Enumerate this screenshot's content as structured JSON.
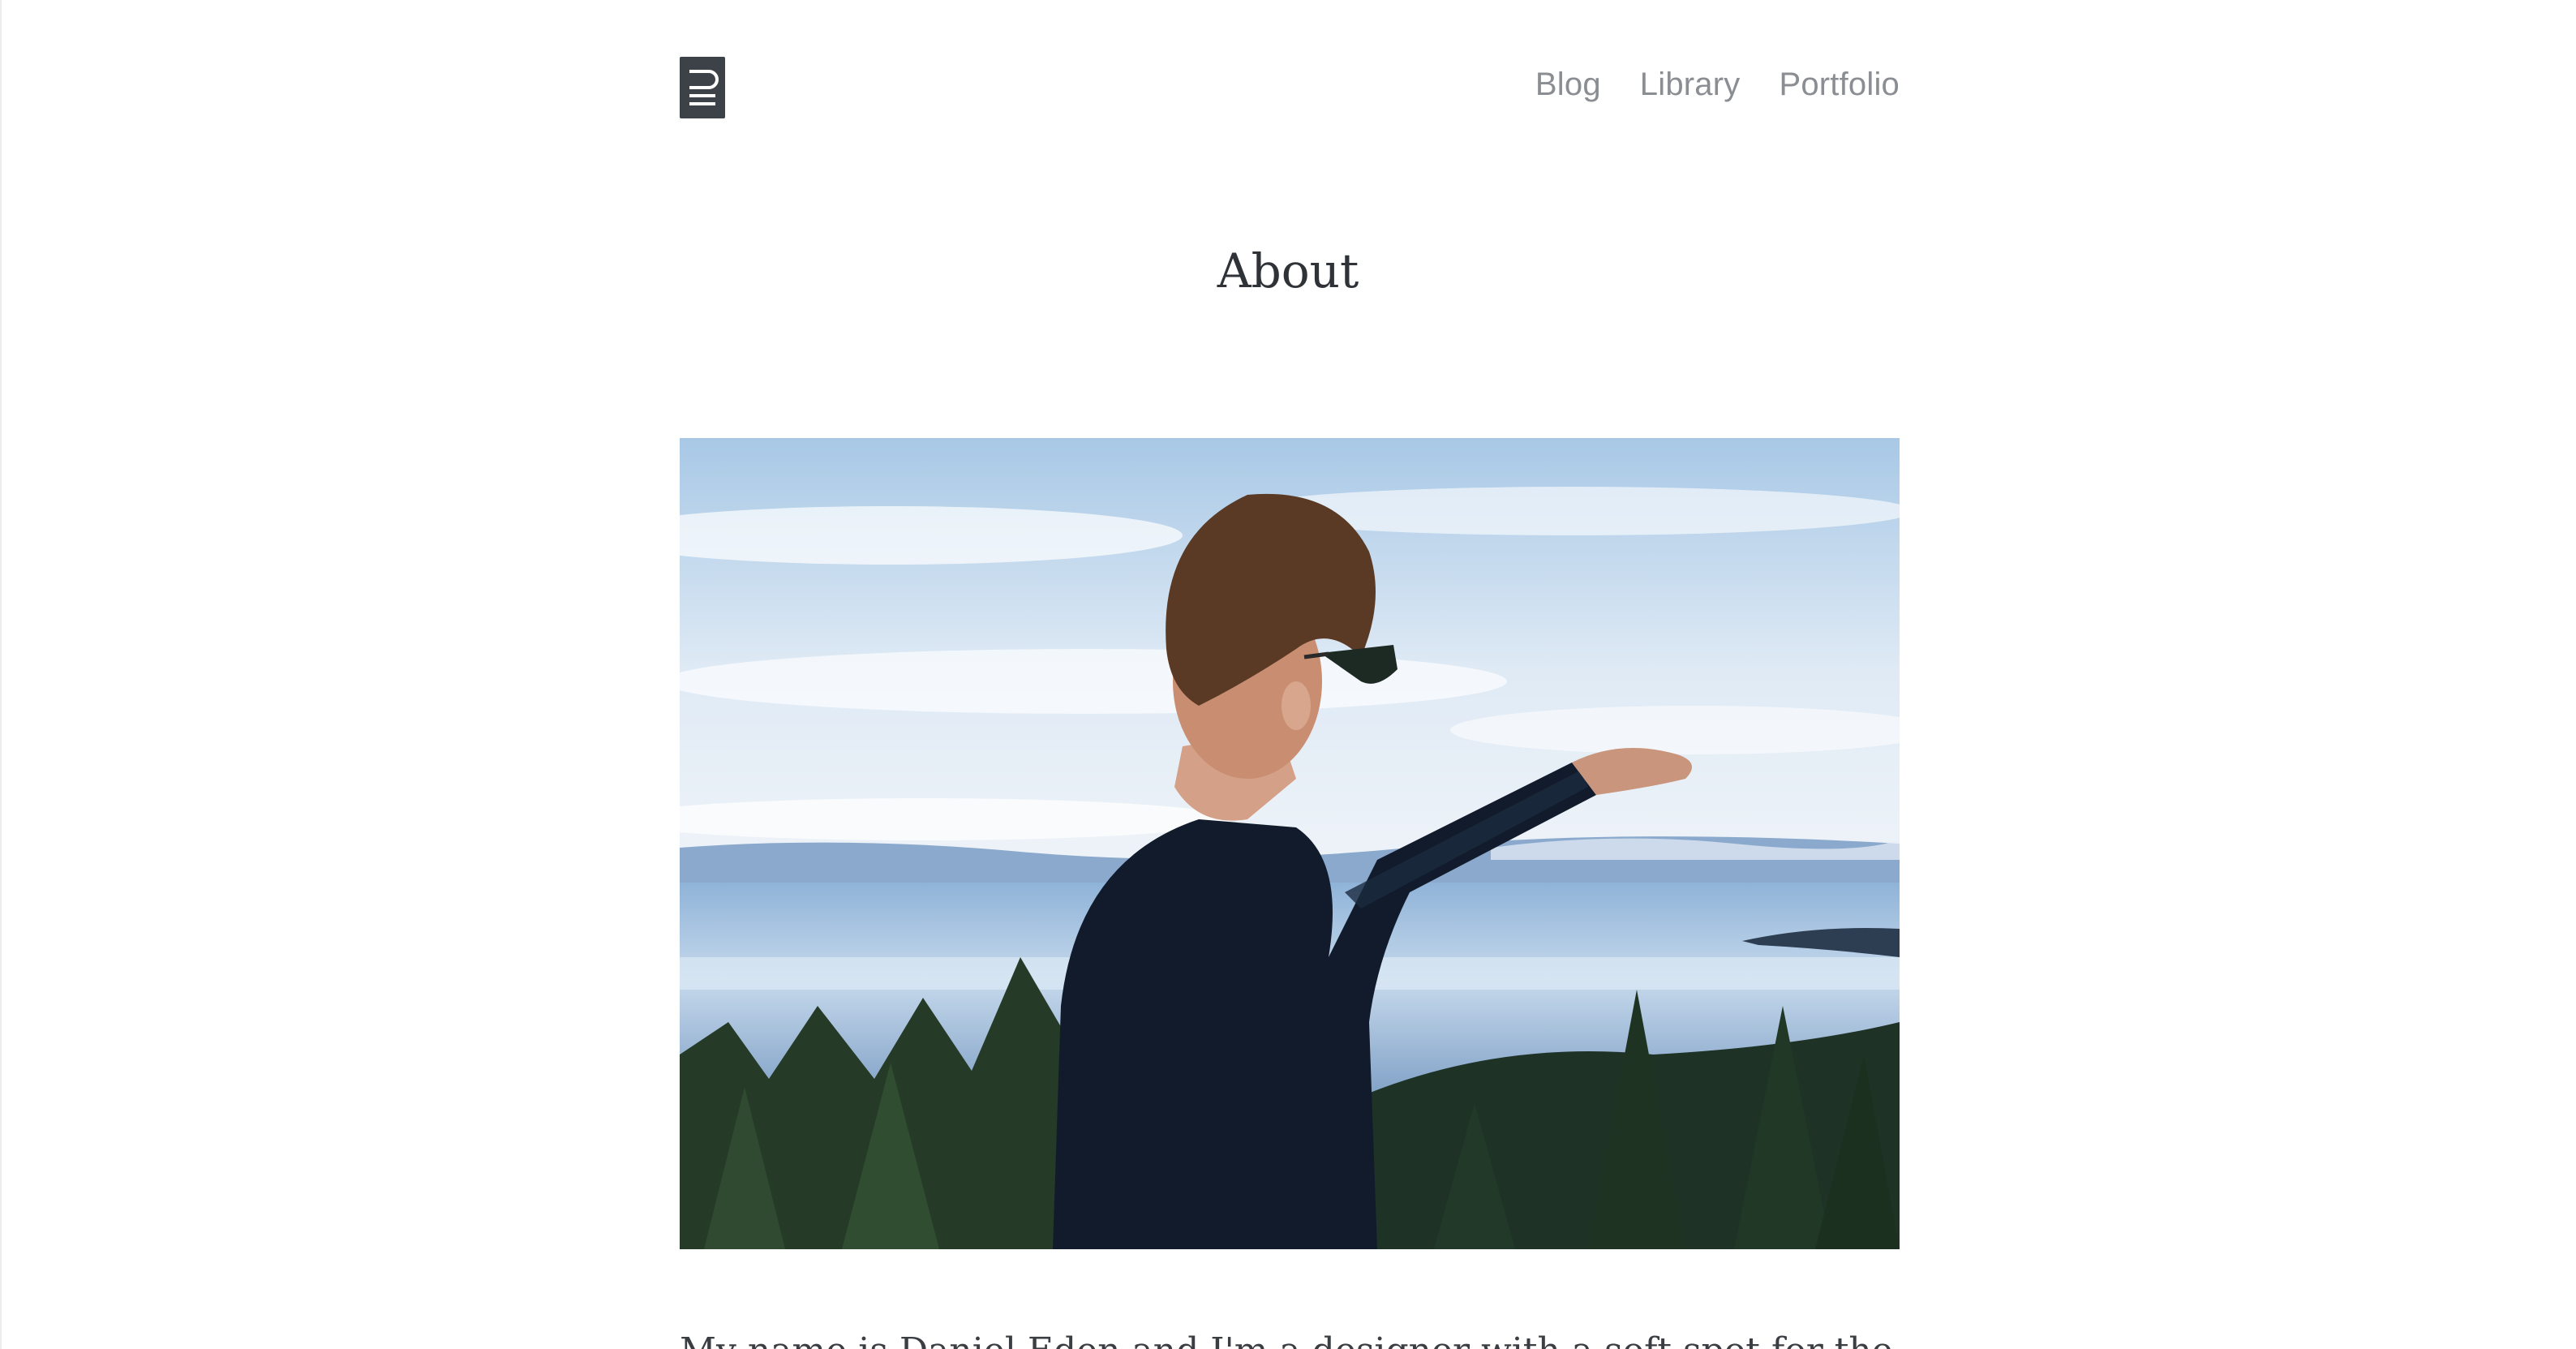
{
  "nav": {
    "items": [
      {
        "label": "Blog"
      },
      {
        "label": "Library"
      },
      {
        "label": "Portfolio"
      }
    ]
  },
  "page": {
    "title": "About",
    "intro_text": "My name is Daniel Eden and I'm a designer with a soft spot for the web."
  },
  "colors": {
    "logo_bg": "#3d4148",
    "nav_text": "#8a8d92",
    "title_text": "#2f3338",
    "sky": "#b9d3ea",
    "lake": "#7fa6cf",
    "sweater": "#111b2b"
  },
  "icons": {
    "logo": "daniel-eden-logo-mark"
  }
}
